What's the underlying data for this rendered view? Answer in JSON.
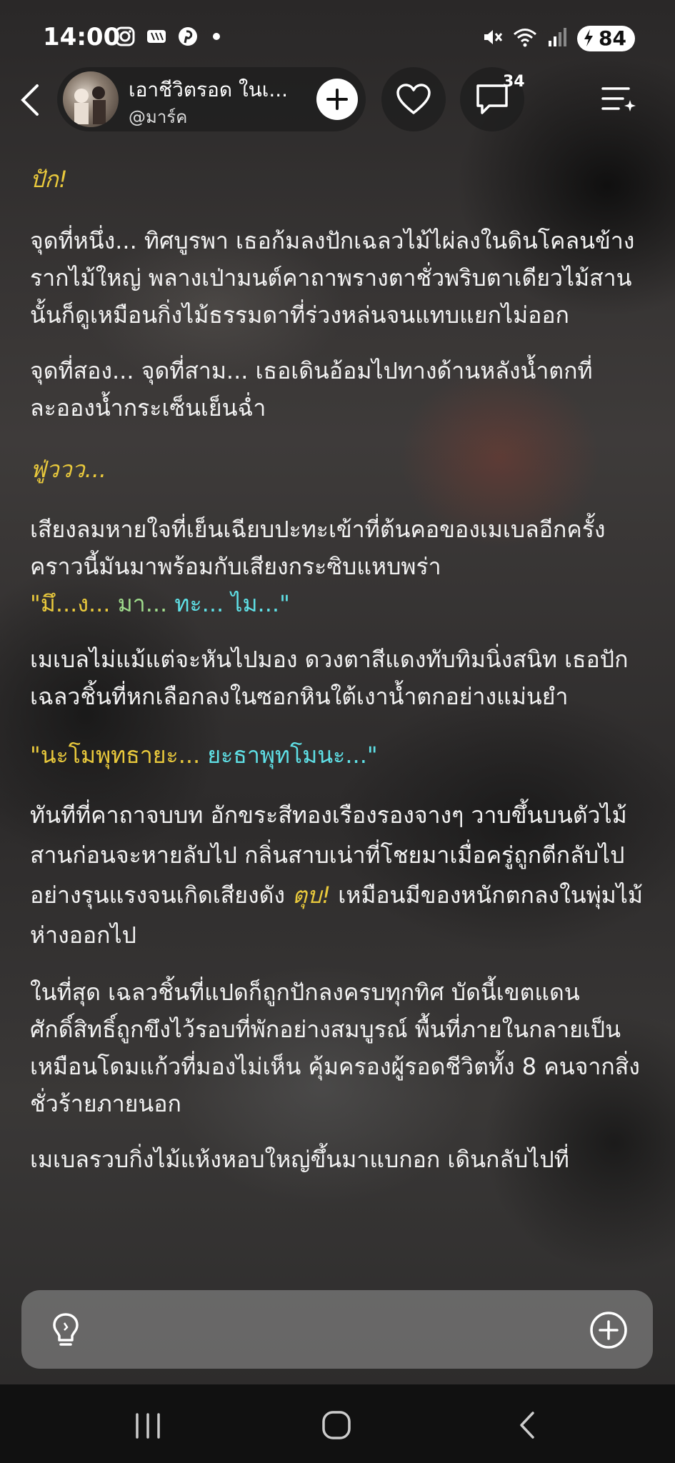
{
  "status": {
    "time": "14:00",
    "battery": "84",
    "left_icons": [
      "instagram-icon",
      "app-icon",
      "pinterest-icon",
      "dot-icon"
    ],
    "right_icons": [
      "mute-icon",
      "wifi-icon",
      "signal-icon",
      "battery-charging-icon"
    ]
  },
  "header": {
    "story_title": "เอาชีวิตรอด ในเ...",
    "author": "@มาร์ค",
    "comment_count": "34"
  },
  "content": {
    "p1": "ปัก!",
    "p2": "จุดที่หนึ่ง... ทิศบูรพา เธอก้มลงปักเฉลวไม้ไผ่ลงในดินโคลนข้างรากไม้ใหญ่ พลางเป่ามนต์คาถาพรางตาชั่วพริบตาเดียวไม้สานนั้นก็ดูเหมือนกิ่งไม้ธรรมดาที่ร่วงหล่นจนแทบแยกไม่ออก",
    "p3": "จุดที่สอง... จุดที่สาม... เธอเดินอ้อมไปทางด้านหลังน้ำตกที่ละอองน้ำกระเซ็นเย็นฉ่ำ",
    "p4": "ฟู่ววว...",
    "p5": "เสียงลมหายใจที่เย็นเฉียบปะทะเข้าที่ต้นคอของเมเบลอีกครั้ง คราวนี้มันมาพร้อมกับเสียงกระซิบแหบพร่า",
    "p5_q1": "\"มึ...ง...",
    "p5_q2": " มา... ",
    "p5_q3": "ทะ... ไม...\"",
    "p6": "เมเบลไม่แม้แต่จะหันไปมอง ดวงตาสีแดงทับทิมนิ่งสนิท เธอปักเฉลวชิ้นที่หกเลือกลงในซอกหินใต้เงาน้ำตกอย่างแม่นยำ",
    "p7_a": "\"นะโมพุทธายะ...",
    "p7_b": " ยะธาพุทโมนะ...\"",
    "p8_a": "ทันทีที่คาถาจบบท อักขระสีทองเรืองรองจางๆ วาบขึ้นบนตัวไม้สานก่อนจะหายลับไป กลิ่นสาบเน่าที่โชยมาเมื่อครู่ถูกตีกลับไปอย่างรุนแรงจนเกิดเสียงดัง ",
    "p8_b": "ตุบ!",
    "p8_c": " เหมือนมีของหนักตกลงในพุ่มไม้ห่างออกไป",
    "p9": "ในที่สุด เฉลวชิ้นที่แปดก็ถูกปักลงครบทุกทิศ บัดนี้เขตแดนศักดิ์สิทธิ์ถูกขึงไว้รอบที่พักอย่างสมบูรณ์ พื้นที่ภายในกลายเป็นเหมือนโดมแก้วที่มองไม่เห็น คุ้มครองผู้รอดชีวิตทั้ง 8 คนจากสิ่งชั่วร้ายภายนอก",
    "p10": "เมเบลรวบกิ่งไม้แห้งหอบใหญ่ขึ้นมาแบกอก เดินกลับไปที่"
  },
  "colors": {
    "accent_yellow": "#e9c93c",
    "accent_cyan": "#5fe0e6"
  }
}
